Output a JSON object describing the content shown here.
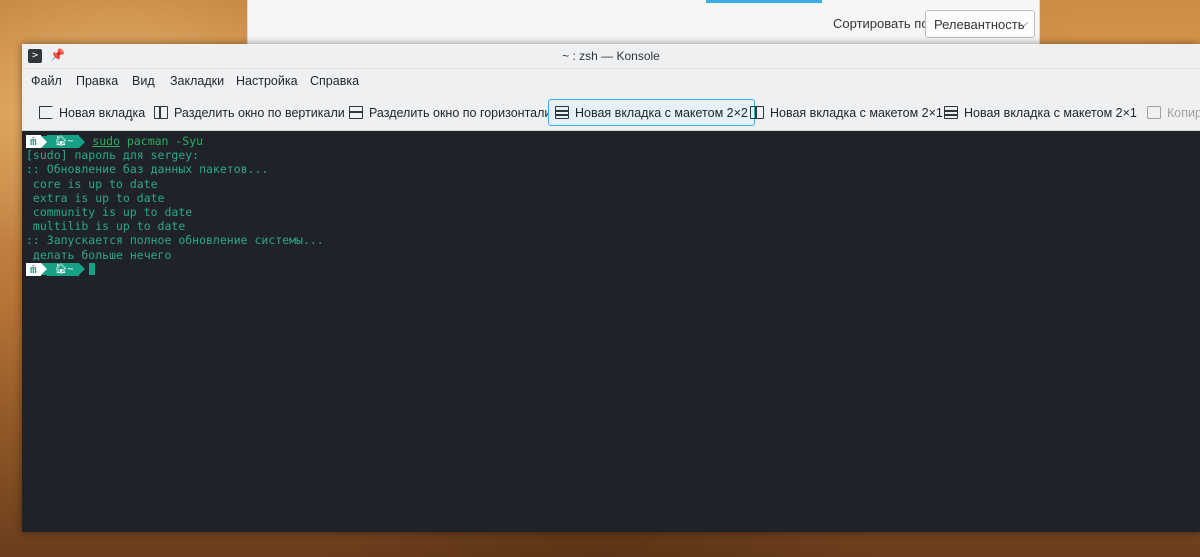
{
  "background_window": {
    "sort_label": "Сортировать по",
    "sort_value": "Релевантность"
  },
  "konsole": {
    "title": "~ : zsh — Konsole",
    "menu": [
      "Файл",
      "Правка",
      "Вид",
      "Закладки",
      "Настройка",
      "Справка"
    ],
    "toolbar": {
      "new_tab": "Новая вкладка",
      "split_vertical": "Разделить окно по вертикали",
      "split_horizontal": "Разделить окно по горизонтали",
      "new_tab_2x2": "Новая вкладка с макетом 2×2",
      "new_tab_2x1_a": "Новая вкладка с макетом 2×1",
      "new_tab_2x1_b": "Новая вкладка с макетом 2×1",
      "copy": "Копиро"
    },
    "terminal": {
      "prompt_dir": "~",
      "command_sudo": "sudo",
      "command_rest": " pacman -Syu",
      "output": [
        "[sudo] пароль для sergey:",
        ":: Обновление баз данных пакетов...",
        " core is up to date",
        " extra is up to date",
        " community is up to date",
        " multilib is up to date",
        ":: Запускается полное обновление системы...",
        " делать больше нечего"
      ]
    }
  },
  "colors": {
    "accent": "#3daee9",
    "terminal_bg": "#1f2329",
    "terminal_fg": "#2aa889",
    "prompt_teal": "#16a085"
  },
  "icons": {
    "app": "terminal-icon",
    "pin": "pin-icon",
    "os_logo": "manjaro-logo-icon",
    "home": "home-icon"
  }
}
